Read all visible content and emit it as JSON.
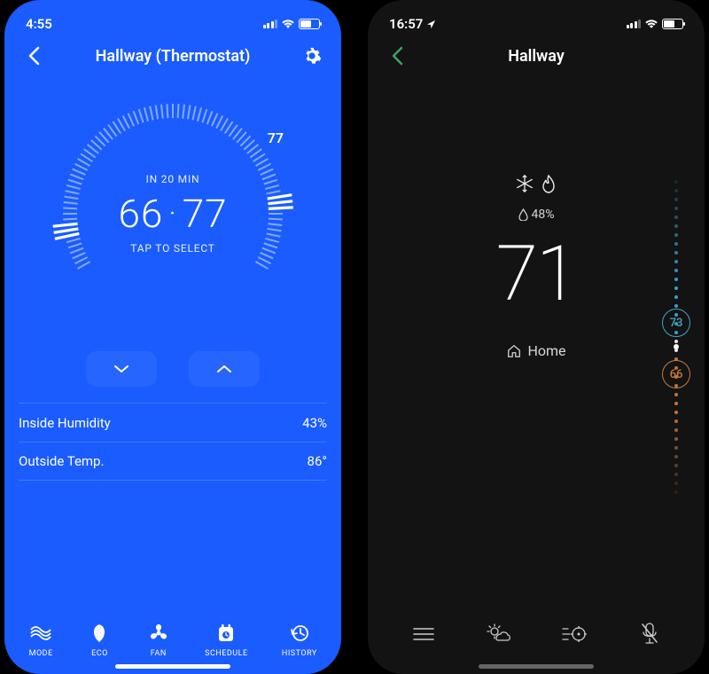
{
  "left": {
    "status_time": "4:55",
    "title": "Hallway (Thermostat)",
    "eta": "IN 20 MIN",
    "range_low": "66",
    "range_high": "77",
    "tap_hint": "TAP TO SELECT",
    "target_marker": "77",
    "rows": {
      "humidity_label": "Inside Humidity",
      "humidity_value": "43%",
      "outside_label": "Outside Temp.",
      "outside_value": "86°"
    },
    "tabs": {
      "mode": "MODE",
      "eco": "ECO",
      "fan": "FAN",
      "schedule": "SCHEDULE",
      "history": "HISTORY"
    }
  },
  "right": {
    "status_time": "16:57",
    "title": "Hallway",
    "humidity": "48%",
    "current_temp": "71",
    "room_label": "Home",
    "cool_setpoint": "73",
    "heat_setpoint": "66"
  }
}
